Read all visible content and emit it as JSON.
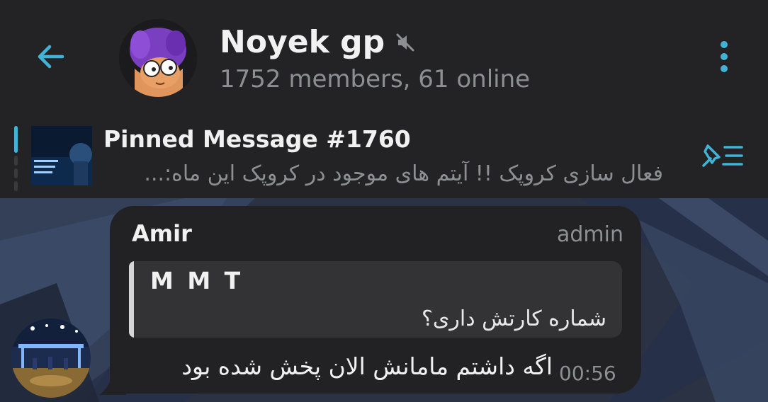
{
  "header": {
    "title": "Noyek gp",
    "subtitle": "1752 members, 61 online",
    "icons": {
      "back": "arrow-left-icon",
      "mute": "mute-icon",
      "menu": "more-vertical-icon"
    }
  },
  "pinned": {
    "title": "Pinned Message #1760",
    "preview": "فعال سازی کروپک !!  آیتم های موجود در کروپک این ماه:...",
    "thumb_text": "خرید کرو\nحورستاپ",
    "icons": {
      "list": "pin-list-icon"
    }
  },
  "message": {
    "sender": "Amir",
    "badge": "admin",
    "reply": {
      "name": "M M T",
      "text": "شماره کارتش داری؟"
    },
    "text": "اگه داشتم مامانش الان پخش شده بود",
    "time": "00:56"
  },
  "colors": {
    "accent": "#41b3d6",
    "header_bg": "#232325",
    "bubble_bg": "#222224",
    "reply_bg": "#333335",
    "muted_text": "#8d8f93",
    "primary_text": "#f1f1f1"
  }
}
